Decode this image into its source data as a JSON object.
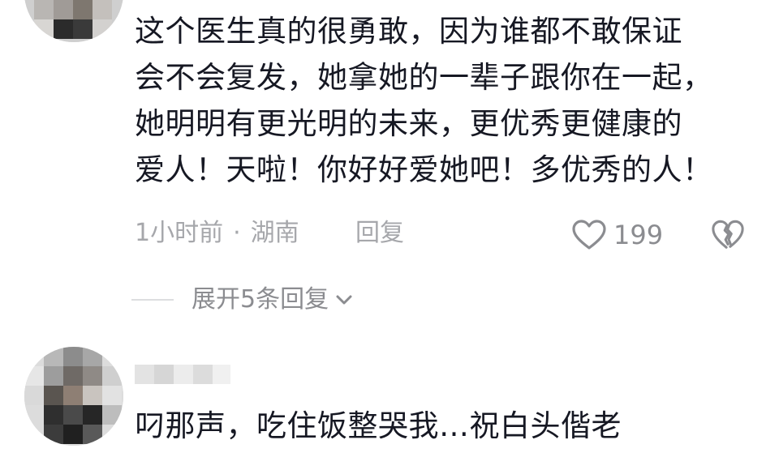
{
  "comments": [
    {
      "text": "这个医生真的很勇敢，因为谁都不敢保证\n会不会复发，她拿她的一辈子跟你在一起，\n她明明有更光明的未来，更优秀更健康的\n爱人！天啦！你好好爱她吧！多优秀的人！",
      "time": "1小时前",
      "separator": "·",
      "location": "湖南",
      "reply_label": "回复",
      "like_count": "199",
      "like_icon": "heart-outline-icon",
      "dislike_icon": "broken-heart-icon"
    },
    {
      "text": "叼那声，吃住饭整哭我…祝白头偕老"
    }
  ],
  "expand_replies": {
    "label": "展开5条回复",
    "icon": "chevron-down-icon"
  },
  "colors": {
    "text_primary": "#161823",
    "text_secondary": "#a6a7ab",
    "text_tertiary": "#8b8c90",
    "divider": "#dddee0",
    "icon": "#8b8c90"
  }
}
